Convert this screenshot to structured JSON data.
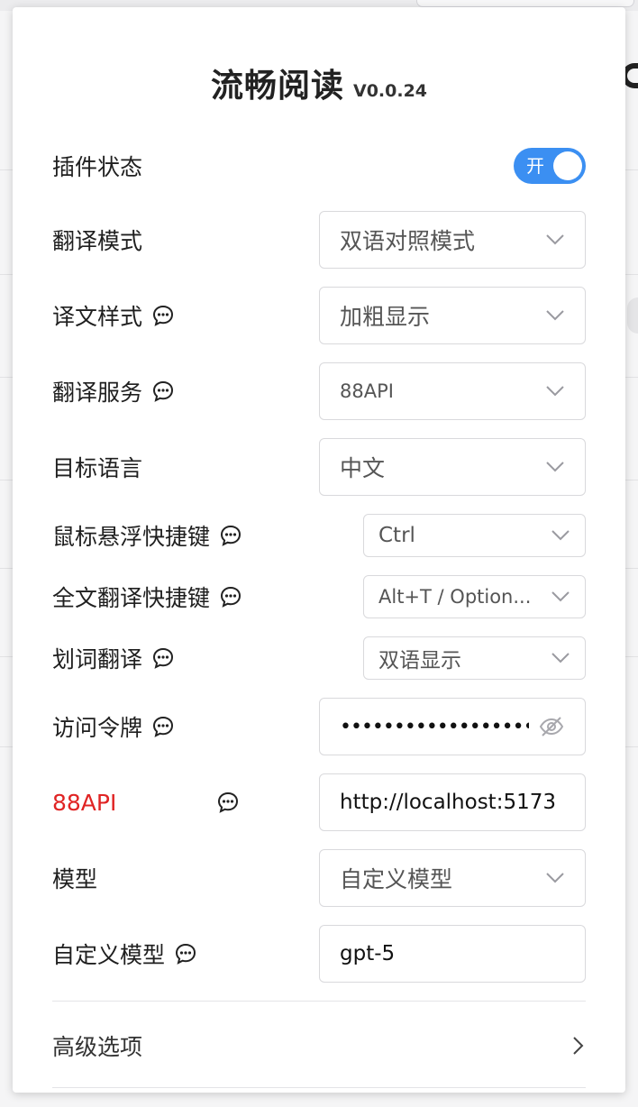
{
  "header": {
    "title": "流畅阅读",
    "version": "V0.0.24"
  },
  "rows": {
    "plugin_status": {
      "label": "插件状态",
      "toggle_text": "开",
      "on": true
    },
    "translate_mode": {
      "label": "翻译模式",
      "value": "双语对照模式"
    },
    "translate_style": {
      "label": "译文样式",
      "value": "加粗显示"
    },
    "translate_service": {
      "label": "翻译服务",
      "value": "88API"
    },
    "target_language": {
      "label": "目标语言",
      "value": "中文"
    },
    "hover_hotkey": {
      "label": "鼠标悬浮快捷键",
      "value": "Ctrl"
    },
    "fulltext_hotkey": {
      "label": "全文翻译快捷键",
      "value": "Alt+T / Option..."
    },
    "selection_translate": {
      "label": "划词翻译",
      "value": "双语显示"
    },
    "access_token": {
      "label": "访问令牌",
      "value": "•••••••••••••••••••••"
    },
    "api_url": {
      "label": "88API",
      "value": "http://localhost:5173"
    },
    "model": {
      "label": "模型",
      "value": "自定义模型"
    },
    "custom_model": {
      "label": "自定义模型",
      "value": "gpt-5"
    }
  },
  "advanced": {
    "label": "高级选项"
  },
  "colors": {
    "accent": "#3b8ff2",
    "service_label": "#e02424"
  }
}
